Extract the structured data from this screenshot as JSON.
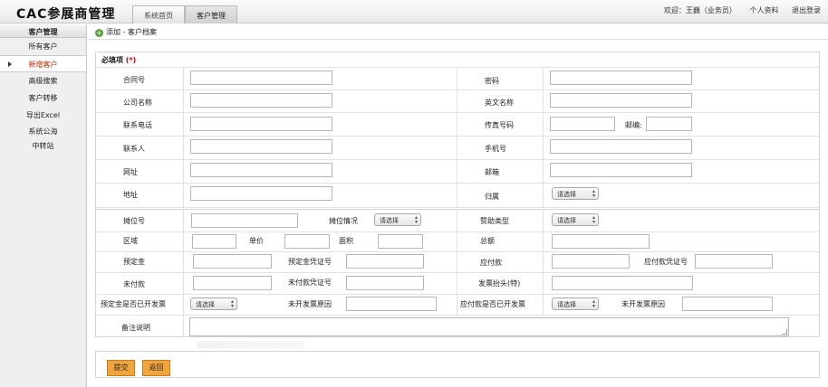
{
  "app": {
    "title": "CAC参展商管理",
    "tabs": [
      {
        "label": "系统首页"
      },
      {
        "label": "客户管理"
      }
    ],
    "welcome": "欢迎：王巍（业务员）",
    "profile_link": "个人资料",
    "logout_link": "退出登录"
  },
  "sidebar": {
    "title": "客户管理",
    "items": [
      {
        "label": "所有客户"
      },
      {
        "label": "新增客户"
      },
      {
        "label": "高级搜索"
      },
      {
        "label": "客户转移"
      },
      {
        "label": "导出Excel"
      },
      {
        "label": "系统公海"
      },
      {
        "label": "中转站"
      }
    ]
  },
  "breadcrumb": "添加 - 客户档案",
  "form": {
    "required_title": "必填项",
    "required_mark": "(*)",
    "labels": {
      "contract_no": "合同号",
      "password": "密码",
      "company_name": "公司名称",
      "english_name": "英文名称",
      "phone": "联系电话",
      "fax": "传真号码",
      "postcode": "邮编:",
      "contact": "联系人",
      "mobile": "手机号",
      "website": "网址",
      "email": "邮箱",
      "address": "地址",
      "owner": "归属",
      "booth_no": "摊位号",
      "booth_status": "摊位情况",
      "sponsor_type": "赞助类型",
      "region": "区域",
      "unit_price": "单价",
      "area": "面积",
      "total": "总额",
      "deposit": "预定金",
      "deposit_voucher": "预定金凭证号",
      "payable": "应付款",
      "payable_voucher": "应付款凭证号",
      "unpaid": "未付款",
      "unpaid_voucher": "未付款凭证号",
      "invoice_title": "发票抬头(特)",
      "deposit_invoiced": "预定金是否已开发票",
      "no_invoice_reason": "未开发票原因",
      "payable_invoiced": "应付款是否已开发票",
      "no_invoice_reason2": "未开发票原因",
      "remarks": "备注说明"
    },
    "select_placeholder": "请选择"
  },
  "buttons": {
    "submit": "提交",
    "back": "返回"
  },
  "colors": {
    "button_bg": "#f0a63c",
    "required": "#cc0000",
    "active_nav": "#cc2200"
  }
}
